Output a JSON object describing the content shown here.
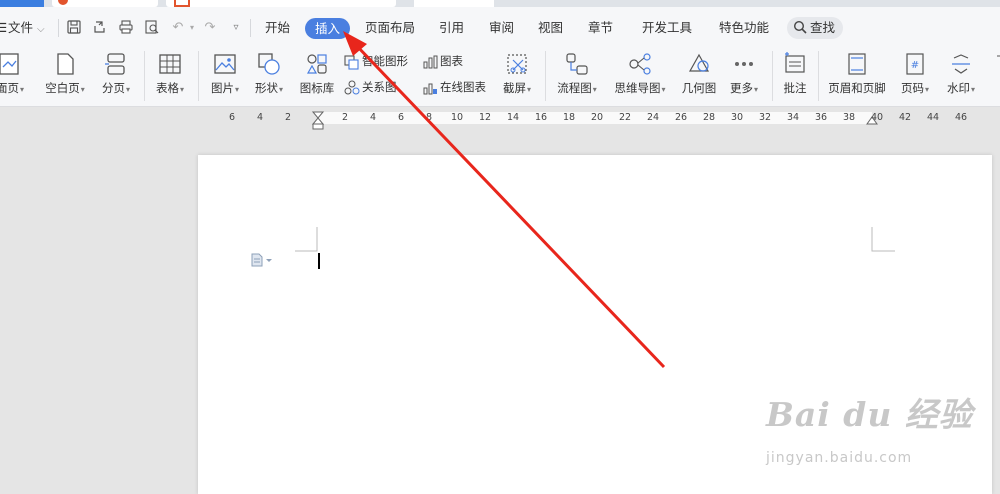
{
  "menu": {
    "file_label": "文件",
    "tabs": [
      "开始",
      "插入",
      "页面布局",
      "引用",
      "审阅",
      "视图",
      "章节",
      "开发工具",
      "特色功能"
    ],
    "active_tab": "插入",
    "search_label": "查找"
  },
  "ribbon": {
    "cover_page": "面页",
    "blank_page": "空白页",
    "page_break": "分页",
    "table": "表格",
    "picture": "图片",
    "shape": "形状",
    "icon_library": "图标库",
    "smart_art": "智能图形",
    "chart": "图表",
    "relation_chart": "关系图",
    "online_chart": "在线图表",
    "screenshot": "截屏",
    "flowchart": "流程图",
    "mindmap": "思维导图",
    "geometry": "几何图",
    "more": "更多",
    "comment": "批注",
    "header_footer": "页眉和页脚",
    "page_number": "页码",
    "watermark": "水印"
  },
  "ruler": {
    "labels": [
      "6",
      "4",
      "2",
      "2",
      "4",
      "6",
      "8",
      "10",
      "12",
      "14",
      "16",
      "18",
      "20",
      "22",
      "24",
      "26",
      "28",
      "30",
      "32",
      "34",
      "36",
      "38",
      "40",
      "42",
      "44",
      "46"
    ]
  },
  "watermark": {
    "logo_text": "Bai du 经验",
    "url": "jingyan.baidu.com"
  },
  "colors": {
    "accent": "#4a7fe0",
    "arrow": "#e8261c"
  }
}
